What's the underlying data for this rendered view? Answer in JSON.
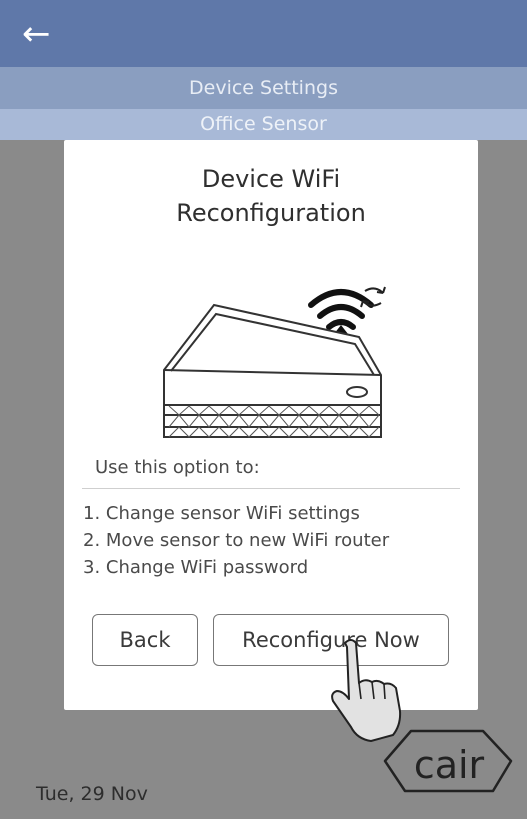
{
  "header": {
    "back_icon": "arrow-left-icon",
    "title": "Device Settings",
    "subtitle": "Office Sensor"
  },
  "dialog": {
    "title_line1": "Device WiFi",
    "title_line2": "Reconfiguration",
    "intro": "Use this option to:",
    "options": [
      "1. Change sensor WiFi settings",
      "2. Move sensor to new WiFi router",
      "3. Change WiFi password"
    ],
    "back_label": "Back",
    "reconfigure_label": "Reconfigure Now"
  },
  "footer": {
    "date": "Tue, 29 Nov",
    "logo_text": "cair"
  },
  "colors": {
    "appbar": "#5f78a9",
    "title_bar": "#8a9ec0",
    "sub_bar": "#a8b9d7",
    "overlay": "#8a8a8a"
  }
}
